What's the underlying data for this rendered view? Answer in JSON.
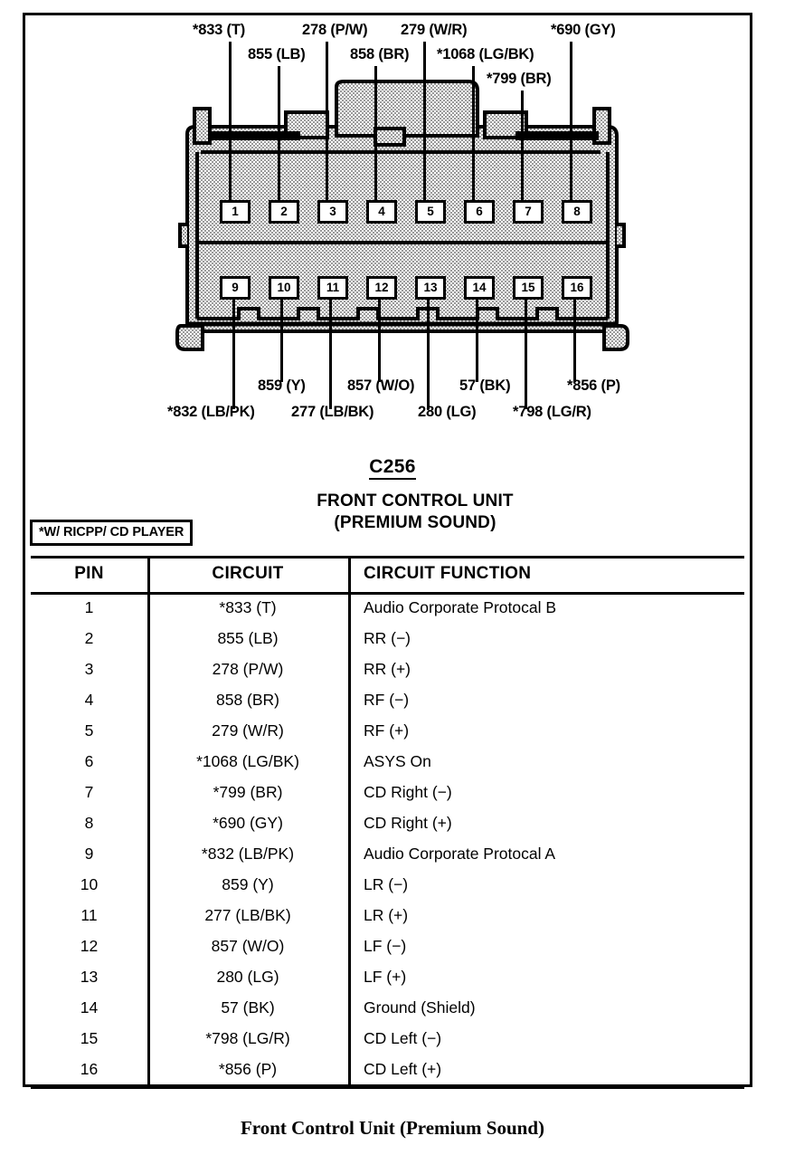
{
  "diagram": {
    "connector_id": "C256",
    "title_line1": "FRONT CONTROL UNIT",
    "title_line2": "(PREMIUM SOUND)",
    "note": "*W/ RICPP/ CD PLAYER",
    "top_labels": [
      {
        "pin": "1",
        "text": "*833 (T)"
      },
      {
        "pin": "2",
        "text": "855 (LB)"
      },
      {
        "pin": "3",
        "text": "278 (P/W)"
      },
      {
        "pin": "4",
        "text": "858 (BR)"
      },
      {
        "pin": "5",
        "text": "279 (W/R)"
      },
      {
        "pin": "6",
        "text": "*1068 (LG/BK)"
      },
      {
        "pin": "7",
        "text": "*799 (BR)"
      },
      {
        "pin": "8",
        "text": "*690 (GY)"
      }
    ],
    "bottom_labels": [
      {
        "pin": "9",
        "text": "*832 (LB/PK)"
      },
      {
        "pin": "10",
        "text": "859 (Y)"
      },
      {
        "pin": "11",
        "text": "277 (LB/BK)"
      },
      {
        "pin": "12",
        "text": "857 (W/O)"
      },
      {
        "pin": "13",
        "text": "280 (LG)"
      },
      {
        "pin": "14",
        "text": "57 (BK)"
      },
      {
        "pin": "15",
        "text": "*798 (LG/R)"
      },
      {
        "pin": "16",
        "text": "*856 (P)"
      }
    ],
    "pin_numbers_top": [
      "1",
      "2",
      "3",
      "4",
      "5",
      "6",
      "7",
      "8"
    ],
    "pin_numbers_bottom": [
      "9",
      "10",
      "11",
      "12",
      "13",
      "14",
      "15",
      "16"
    ]
  },
  "table": {
    "headers": [
      "PIN",
      "CIRCUIT",
      "CIRCUIT FUNCTION"
    ],
    "rows": [
      {
        "pin": "1",
        "circuit": "*833 (T)",
        "function": "Audio Corporate Protocal B"
      },
      {
        "pin": "2",
        "circuit": "855 (LB)",
        "function": "RR (−)"
      },
      {
        "pin": "3",
        "circuit": "278 (P/W)",
        "function": "RR (+)"
      },
      {
        "pin": "4",
        "circuit": "858 (BR)",
        "function": "RF (−)"
      },
      {
        "pin": "5",
        "circuit": "279 (W/R)",
        "function": "RF (+)"
      },
      {
        "pin": "6",
        "circuit": "*1068 (LG/BK)",
        "function": "ASYS On"
      },
      {
        "pin": "7",
        "circuit": "*799 (BR)",
        "function": "CD Right (−)"
      },
      {
        "pin": "8",
        "circuit": "*690 (GY)",
        "function": "CD Right (+)"
      },
      {
        "pin": "9",
        "circuit": "*832 (LB/PK)",
        "function": "Audio Corporate Protocal A"
      },
      {
        "pin": "10",
        "circuit": "859 (Y)",
        "function": "LR (−)"
      },
      {
        "pin": "11",
        "circuit": "277 (LB/BK)",
        "function": "LR (+)"
      },
      {
        "pin": "12",
        "circuit": "857 (W/O)",
        "function": "LF (−)"
      },
      {
        "pin": "13",
        "circuit": "280 (LG)",
        "function": "LF (+)"
      },
      {
        "pin": "14",
        "circuit": "57 (BK)",
        "function": "Ground (Shield)"
      },
      {
        "pin": "15",
        "circuit": "*798 (LG/R)",
        "function": "CD Left (−)"
      },
      {
        "pin": "16",
        "circuit": "*856 (P)",
        "function": "CD Left (+)"
      }
    ]
  },
  "caption": "Front Control Unit (Premium Sound)",
  "colors": {
    "line": "#000000",
    "body_fill": "#d8d8d8",
    "page": "#ffffff"
  }
}
